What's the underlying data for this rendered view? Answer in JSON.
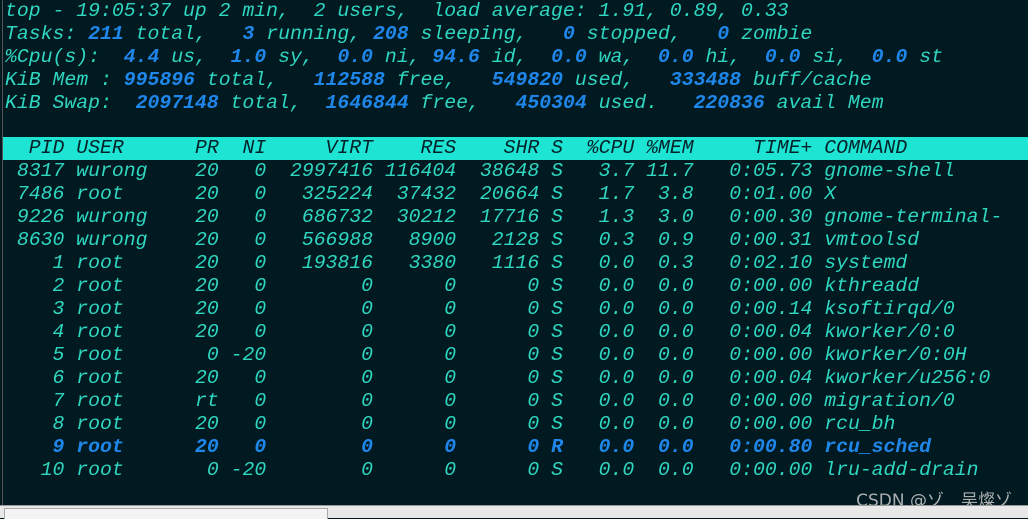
{
  "summary": [
    [
      [
        "top - 19:05:37 up 2 min,  2 users,  load average: 1.91, 0.89, 0.33",
        0
      ]
    ],
    [
      [
        "Tasks: ",
        0
      ],
      [
        "211",
        1
      ],
      [
        " total,   ",
        0
      ],
      [
        "3",
        1
      ],
      [
        " running, ",
        0
      ],
      [
        "208",
        1
      ],
      [
        " sleeping,   ",
        0
      ],
      [
        "0",
        1
      ],
      [
        " stopped,   ",
        0
      ],
      [
        "0",
        1
      ],
      [
        " zombie",
        0
      ]
    ],
    [
      [
        "%Cpu(s):  ",
        0
      ],
      [
        "4.4",
        1
      ],
      [
        " us,  ",
        0
      ],
      [
        "1.0",
        1
      ],
      [
        " sy,  ",
        0
      ],
      [
        "0.0",
        1
      ],
      [
        " ni, ",
        0
      ],
      [
        "94.6",
        1
      ],
      [
        " id,  ",
        0
      ],
      [
        "0.0",
        1
      ],
      [
        " wa,  ",
        0
      ],
      [
        "0.0",
        1
      ],
      [
        " hi,  ",
        0
      ],
      [
        "0.0",
        1
      ],
      [
        " si,  ",
        0
      ],
      [
        "0.0",
        1
      ],
      [
        " st",
        0
      ]
    ],
    [
      [
        "KiB Mem : ",
        0
      ],
      [
        "995896",
        1
      ],
      [
        " total,   ",
        0
      ],
      [
        "112588",
        1
      ],
      [
        " free,   ",
        0
      ],
      [
        "549820",
        1
      ],
      [
        " used,   ",
        0
      ],
      [
        "333488",
        1
      ],
      [
        " buff/cache",
        0
      ]
    ],
    [
      [
        "KiB Swap:  ",
        0
      ],
      [
        "2097148",
        1
      ],
      [
        " total,  ",
        0
      ],
      [
        "1646844",
        1
      ],
      [
        " free,   ",
        0
      ],
      [
        "450304",
        1
      ],
      [
        " used.   ",
        0
      ],
      [
        "220836",
        1
      ],
      [
        " avail Mem",
        0
      ]
    ]
  ],
  "columns": [
    "PID",
    "USER",
    "PR",
    "NI",
    "VIRT",
    "RES",
    "SHR",
    "S",
    "%CPU",
    "%MEM",
    "TIME+",
    "COMMAND"
  ],
  "processes": [
    [
      "8317",
      "wurong",
      "20",
      "0",
      "2997416",
      "116404",
      "38648",
      "S",
      "3.7",
      "11.7",
      "0:05.73",
      "gnome-shell"
    ],
    [
      "7486",
      "root",
      "20",
      "0",
      "325224",
      "37432",
      "20664",
      "S",
      "1.7",
      "3.8",
      "0:01.00",
      "X"
    ],
    [
      "9226",
      "wurong",
      "20",
      "0",
      "686732",
      "30212",
      "17716",
      "S",
      "1.3",
      "3.0",
      "0:00.30",
      "gnome-terminal-"
    ],
    [
      "8630",
      "wurong",
      "20",
      "0",
      "566988",
      "8900",
      "2128",
      "S",
      "0.3",
      "0.9",
      "0:00.31",
      "vmtoolsd"
    ],
    [
      "1",
      "root",
      "20",
      "0",
      "193816",
      "3380",
      "1116",
      "S",
      "0.0",
      "0.3",
      "0:02.10",
      "systemd"
    ],
    [
      "2",
      "root",
      "20",
      "0",
      "0",
      "0",
      "0",
      "S",
      "0.0",
      "0.0",
      "0:00.00",
      "kthreadd"
    ],
    [
      "3",
      "root",
      "20",
      "0",
      "0",
      "0",
      "0",
      "S",
      "0.0",
      "0.0",
      "0:00.14",
      "ksoftirqd/0"
    ],
    [
      "4",
      "root",
      "20",
      "0",
      "0",
      "0",
      "0",
      "S",
      "0.0",
      "0.0",
      "0:00.04",
      "kworker/0:0"
    ],
    [
      "5",
      "root",
      "0",
      "-20",
      "0",
      "0",
      "0",
      "S",
      "0.0",
      "0.0",
      "0:00.00",
      "kworker/0:0H"
    ],
    [
      "6",
      "root",
      "20",
      "0",
      "0",
      "0",
      "0",
      "S",
      "0.0",
      "0.0",
      "0:00.04",
      "kworker/u256:0"
    ],
    [
      "7",
      "root",
      "rt",
      "0",
      "0",
      "0",
      "0",
      "S",
      "0.0",
      "0.0",
      "0:00.00",
      "migration/0"
    ],
    [
      "8",
      "root",
      "20",
      "0",
      "0",
      "0",
      "0",
      "S",
      "0.0",
      "0.0",
      "0:00.00",
      "rcu_bh"
    ],
    [
      "9",
      "root",
      "20",
      "0",
      "0",
      "0",
      "0",
      "R",
      "0.0",
      "0.0",
      "0:00.80",
      "rcu_sched"
    ],
    [
      "10",
      "root",
      "0",
      "-20",
      "0",
      "0",
      "0",
      "S",
      "0.0",
      "0.0",
      "0:00.00",
      "lru-add-drain"
    ]
  ],
  "watermark": "CSDN @ゾ　吴燦ゾ",
  "colors": {
    "background": "#011a21",
    "text": "#2fd6c0",
    "highlight": "#1f86ea",
    "header_bar": "#1ee5d3"
  }
}
